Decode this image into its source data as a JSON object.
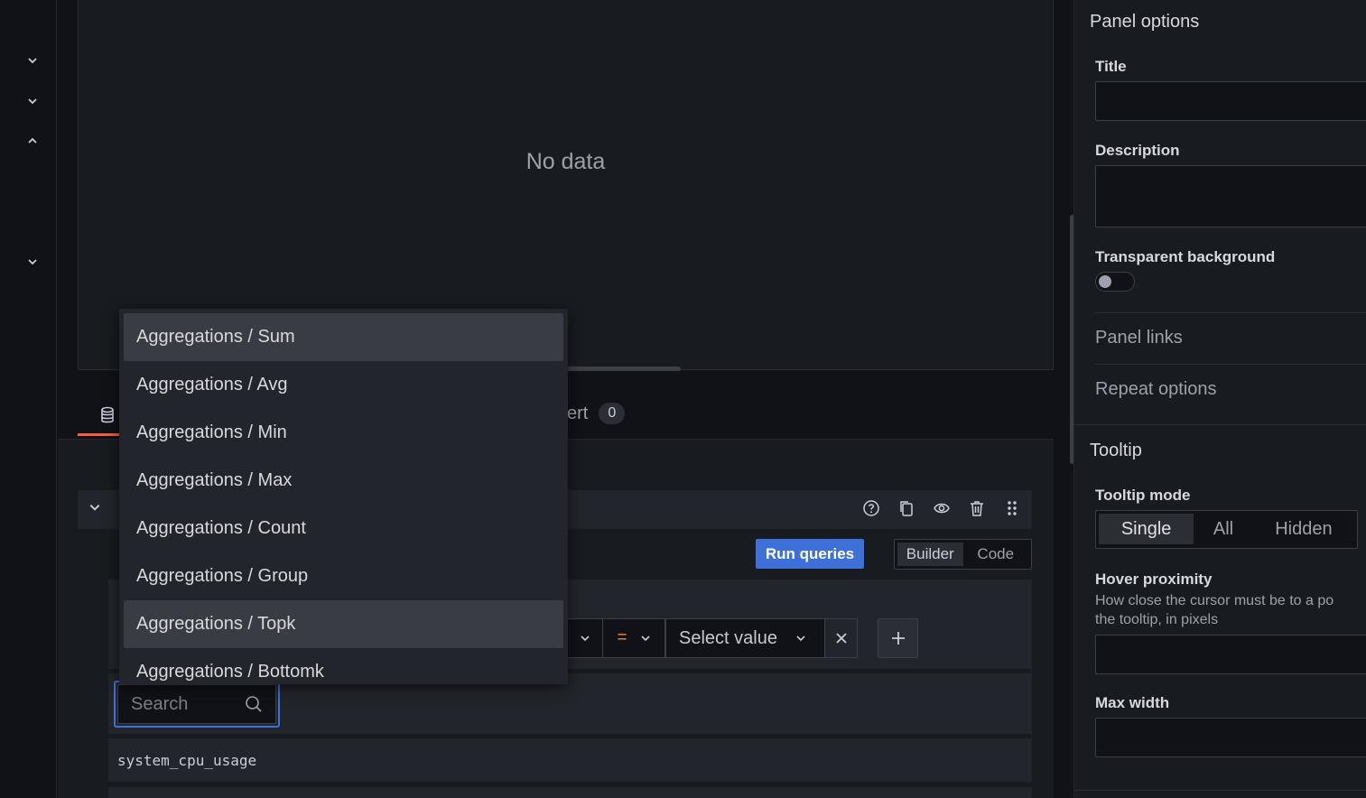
{
  "visualization": {
    "empty_text": "No data"
  },
  "tabs": {
    "alert_label": "ert",
    "alert_count": "0"
  },
  "query": {
    "run_label": "Run queries",
    "mode_builder": "Builder",
    "mode_code": "Code",
    "operator": "=",
    "value_placeholder": "Select value",
    "search_placeholder": "Search",
    "metric": "system_cpu_usage"
  },
  "dropdown": {
    "items": [
      "Aggregations / Sum",
      "Aggregations / Avg",
      "Aggregations / Min",
      "Aggregations / Max",
      "Aggregations / Count",
      "Aggregations / Group",
      "Aggregations / Topk",
      "Aggregations / Bottomk"
    ]
  },
  "options": {
    "section_title": "Panel options",
    "title_label": "Title",
    "description_label": "Description",
    "transparent_label": "Transparent background",
    "panel_links": "Panel links",
    "repeat_options": "Repeat options",
    "tooltip_title": "Tooltip",
    "tooltip_mode_label": "Tooltip mode",
    "tooltip_modes": [
      "Single",
      "All",
      "Hidden"
    ],
    "hover_label": "Hover proximity",
    "hover_help_1": "How close the cursor must be to a po",
    "hover_help_2": "the tooltip, in pixels",
    "max_width_label": "Max width"
  },
  "colors": {
    "accent_blue": "#3d71d9",
    "tab_active": "#f55f3e",
    "operator": "#f58b2f"
  }
}
